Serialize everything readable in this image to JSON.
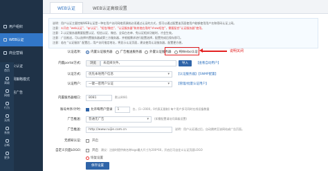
{
  "sidebar": {
    "items": [
      {
        "label": "用户组织"
      },
      {
        "label": "WEB认证"
      },
      {
        "label": "商业营销"
      },
      {
        "label": "办公认证"
      },
      {
        "label": "上网策略模式"
      },
      {
        "label": "微信广告"
      }
    ],
    "mini": [
      {
        "label": "首页"
      },
      {
        "label": "高级"
      },
      {
        "label": "网络"
      },
      {
        "label": "行为"
      },
      {
        "label": "无线"
      },
      {
        "label": "系统"
      },
      {
        "label": "诊断"
      },
      {
        "label": "更多"
      }
    ]
  },
  "tabs": [
    {
      "label": "WEB认证"
    },
    {
      "label": "WEB认证高级设置"
    }
  ],
  "notice": {
    "line1": "说明：用户认证主要控制WEB认证是一种在用户访问网络资源前必须通过认证的方式，您可以通过配置该页面使用户能够使用用户名和密码认证上网。",
    "line2a": "注意：",
    "line2b": "①开启 \"web认证\"、\"qr认证\"、\"短信/微信\"、\"认证服务器\"和其他应用的\"show短信\"，需要配合\"认证服务器\"使用。",
    "line3": "注意：2.认证服务器需要配置认证、短信认证、微信、全局白名单、免认证相关功能时，才会生效。",
    "line4": "注意：广告推送，可以选择内置服务器或第三方服务器，并根据需求进行配置选择，配置完成后保存即可。",
    "line5": "注意：若在 \"认证服务\" 配置后，用户访问指定地址，将显示认证页面，建议使用认证服务器，配置更方便。"
  },
  "form": {
    "auth_type_label": "认证选项：",
    "auth_options": [
      "内置认证服务器",
      "广告推送服务器",
      "外置认证服务器",
      "纯Weibo认证"
    ],
    "portal_label": "内置portal方式：",
    "portal_placeholder": "未选择文件。",
    "portal_browse": "浏览",
    "portal_import": "导入",
    "portal_link": "【查看自动用户】",
    "auth_method_label": "认证方式：",
    "auth_method_value": "优先本地用户信息",
    "auth_method_links": "【认证服务器】【SNMP配置】",
    "auth_user_label": "认证用户：",
    "auth_user_value": "一键一密用户认证",
    "auth_user_link": "【管理/批量认证用户】",
    "port_label": "内置服务器端口：",
    "port_value": "8081",
    "port_hint": "默认8081",
    "timeout_label": "账号共享/计时：",
    "timeout_check": "允许每用户登录",
    "timeout_value": "1",
    "timeout_hint": "台，(1~2000，0代表无限制) 每个用户多可同时在线设备数量",
    "ad_label": "广告推送：",
    "ad_value": "普通无广告",
    "ad_hint": "(如需配置请访问高级设置)",
    "push_url_label": "广告推送：",
    "push_url_value": "http://www.ruijie.com.cn",
    "push_url_hint": "说明：用户认证通过后，自动跳转至该网站或广告页面。",
    "nologin_label": "无感知认证：",
    "nologin_text": "开启",
    "logo_label": "自定义页面LOGO：",
    "logo_text": "开启",
    "logo_hint": "建议：注册时提供商名称logo最大尺寸为200*60，开启后可自定义认证页面LOGO",
    "reset_text": "恢复设置",
    "save": "保存设置"
  },
  "annotation": {
    "callout": "说明关闭"
  },
  "colors": {
    "sidebar": "#1f3247",
    "accent": "#2f64a8",
    "highlight": "#e32020"
  }
}
